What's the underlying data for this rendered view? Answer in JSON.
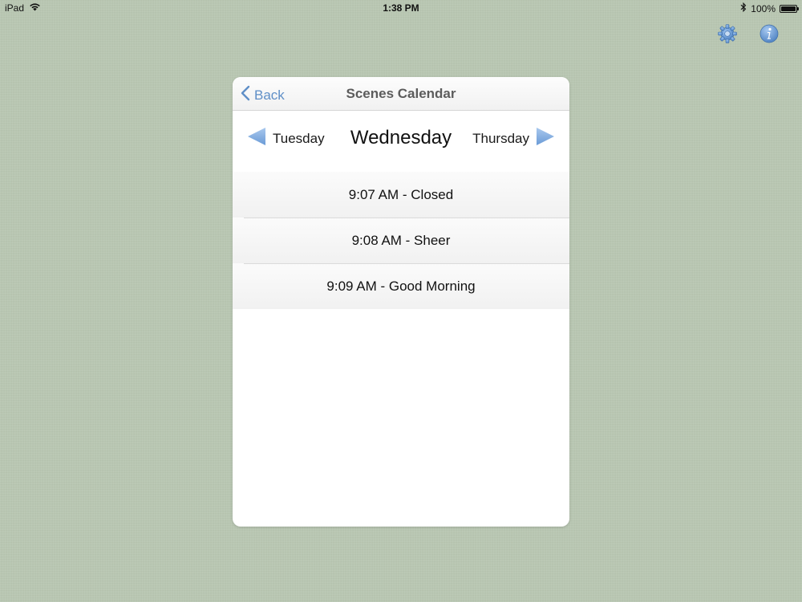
{
  "status_bar": {
    "device": "iPad",
    "time": "1:38 PM",
    "battery_percent": "100%",
    "battery_level": 1.0
  },
  "top_icons": {
    "settings_icon": "gear-icon",
    "info_icon": "info-icon",
    "accent_color": "#5b8fcf"
  },
  "panel": {
    "back_label": "Back",
    "title": "Scenes Calendar",
    "prev_day": "Tuesday",
    "current_day": "Wednesday",
    "next_day": "Thursday",
    "arrow_color": "#7aa7dc"
  },
  "schedule": [
    {
      "label": "9:07 AM - Closed"
    },
    {
      "label": "9:08 AM - Sheer"
    },
    {
      "label": "9:09 AM - Good Morning"
    }
  ]
}
